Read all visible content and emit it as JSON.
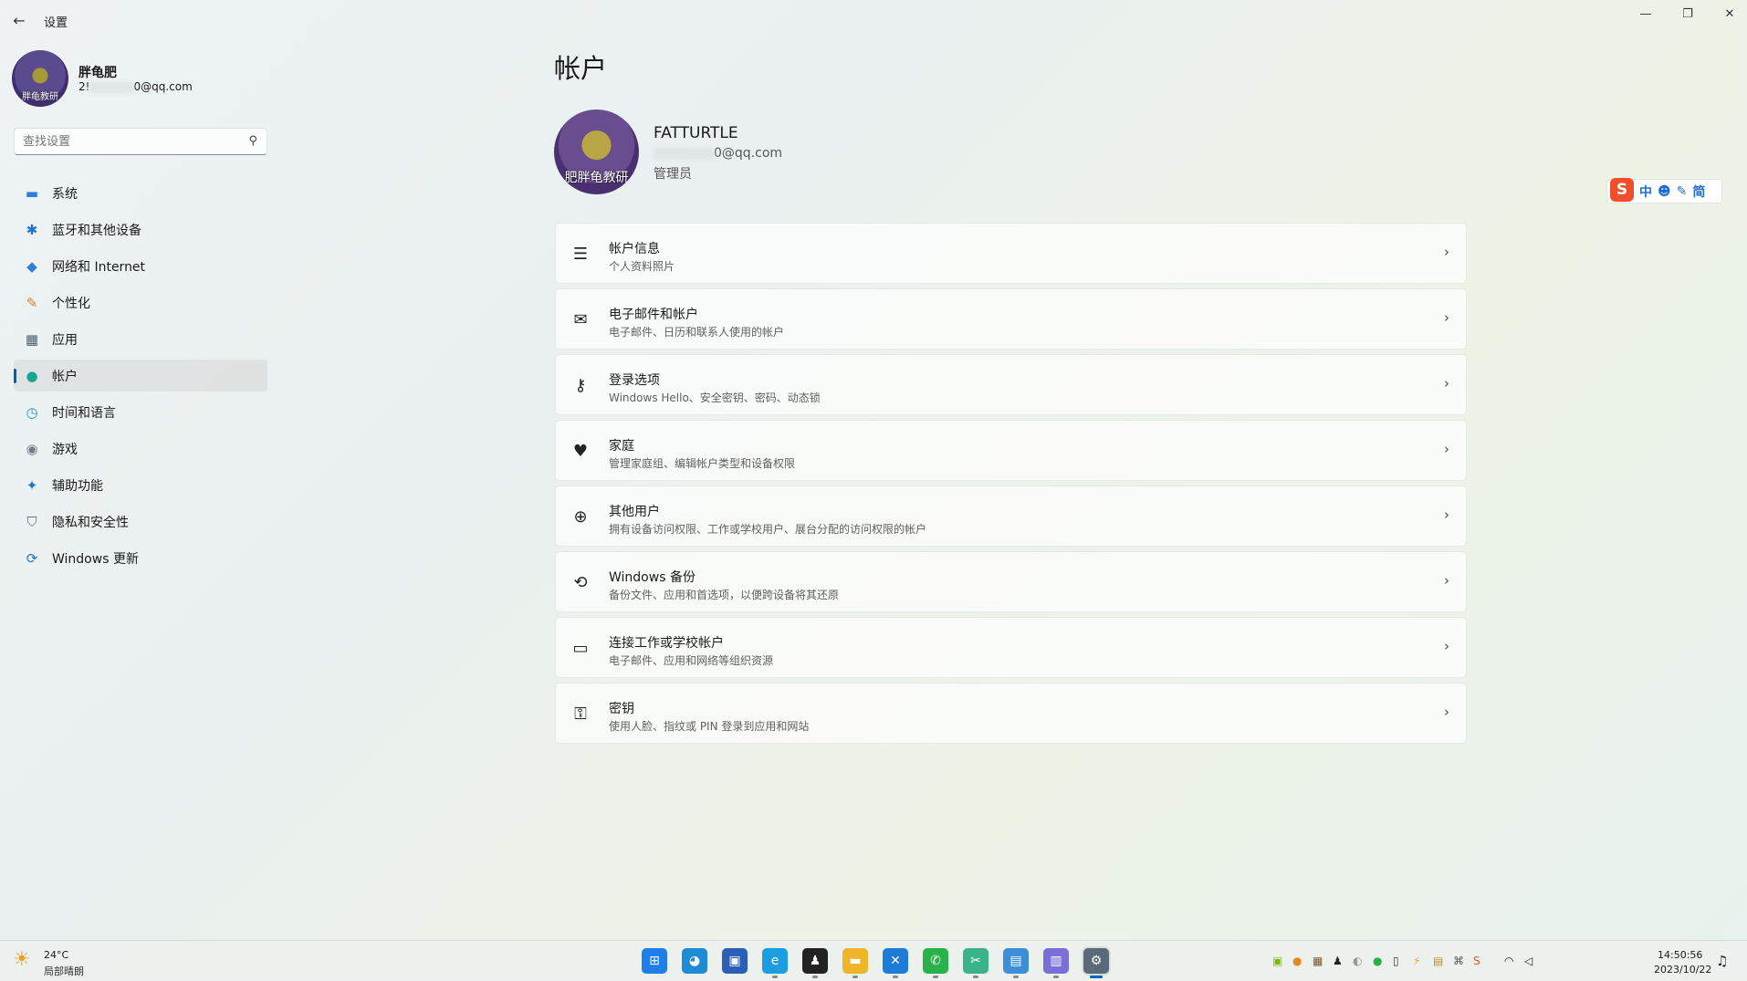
{
  "window": {
    "title": "设置",
    "back_icon": "back-arrow-icon",
    "minimize_glyph": "—",
    "restore_glyph": "❐",
    "close_glyph": "✕"
  },
  "profile": {
    "name": "胖龟肥",
    "email_prefix": "2!",
    "email_suffix": "0@qq.com",
    "avatar_caption": "胖龟教研"
  },
  "search": {
    "placeholder": "查找设置"
  },
  "nav": {
    "items": [
      {
        "label": "系统",
        "icon": "system-icon",
        "glyph": "▬",
        "color": "#2a80d9"
      },
      {
        "label": "蓝牙和其他设备",
        "icon": "bluetooth-icon",
        "glyph": "✱",
        "color": "#1f73d0"
      },
      {
        "label": "网络和 Internet",
        "icon": "wifi-icon",
        "glyph": "◆",
        "color": "#2b7fd8"
      },
      {
        "label": "个性化",
        "icon": "brush-icon",
        "glyph": "✎",
        "color": "#d9822b"
      },
      {
        "label": "应用",
        "icon": "apps-icon",
        "glyph": "▦",
        "color": "#4b5e72"
      },
      {
        "label": "帐户",
        "icon": "account-icon",
        "glyph": "●",
        "color": "#1aa58e"
      },
      {
        "label": "时间和语言",
        "icon": "globe-clock-icon",
        "glyph": "◷",
        "color": "#2b8fd6"
      },
      {
        "label": "游戏",
        "icon": "gamepad-icon",
        "glyph": "◉",
        "color": "#6f7b86"
      },
      {
        "label": "辅助功能",
        "icon": "accessibility-icon",
        "glyph": "✦",
        "color": "#1f73d0"
      },
      {
        "label": "隐私和安全性",
        "icon": "shield-icon",
        "glyph": "⛉",
        "color": "#6b7480"
      },
      {
        "label": "Windows 更新",
        "icon": "update-icon",
        "glyph": "⟳",
        "color": "#1f73d0"
      }
    ]
  },
  "main": {
    "title": "帐户",
    "account": {
      "name": "FATTURTLE",
      "email_suffix": "0@qq.com",
      "role": "管理员",
      "avatar_caption": "肥胖龟教研"
    },
    "cards": [
      {
        "title": "帐户信息",
        "desc": "个人资料照片",
        "icon": "person-info-icon",
        "glyph": "☰"
      },
      {
        "title": "电子邮件和帐户",
        "desc": "电子邮件、日历和联系人使用的帐户",
        "icon": "mail-icon",
        "glyph": "✉"
      },
      {
        "title": "登录选项",
        "desc": "Windows Hello、安全密钥、密码、动态锁",
        "icon": "key-icon",
        "glyph": "⚷"
      },
      {
        "title": "家庭",
        "desc": "管理家庭组、编辑帐户类型和设备权限",
        "icon": "family-heart-icon",
        "glyph": "♥"
      },
      {
        "title": "其他用户",
        "desc": "拥有设备访问权限、工作或学校用户、展台分配的访问权限的帐户",
        "icon": "add-user-icon",
        "glyph": "⊕"
      },
      {
        "title": "Windows 备份",
        "desc": "备份文件、应用和首选项，以便跨设备将其还原",
        "icon": "backup-icon",
        "glyph": "⟲"
      },
      {
        "title": "连接工作或学校帐户",
        "desc": "电子邮件、应用和网络等组织资源",
        "icon": "briefcase-icon",
        "glyph": "▭"
      },
      {
        "title": "密钥",
        "desc": "使用人脸、指纹或 PIN 登录到应用和网站",
        "icon": "passkey-icon",
        "glyph": "⚿"
      }
    ],
    "chevron": "›"
  },
  "ime": {
    "logo": "S",
    "items": [
      "中",
      "☻",
      "✎",
      "简"
    ]
  },
  "taskbar": {
    "weather_temp": "24°C",
    "weather_desc": "局部晴朗",
    "weather_icon": "sun-cloud-icon",
    "apps": [
      {
        "name": "start-icon",
        "color": "#1f7ee8",
        "glyph": "⊞"
      },
      {
        "name": "edge-preview-icon",
        "color": "#1f8ad6",
        "glyph": "◕"
      },
      {
        "name": "store-icon",
        "color": "#2b5fb5",
        "glyph": "▣"
      },
      {
        "name": "edge-icon",
        "color": "#1b9de2",
        "glyph": "e"
      },
      {
        "name": "qq-icon",
        "color": "#222222",
        "glyph": "♟"
      },
      {
        "name": "explorer-icon",
        "color": "#f0b429",
        "glyph": "▬"
      },
      {
        "name": "vscode-icon",
        "color": "#1e7bd6",
        "glyph": "✕"
      },
      {
        "name": "wechat-icon",
        "color": "#2ab24a",
        "glyph": "✆"
      },
      {
        "name": "xmind-icon",
        "color": "#3bb38a",
        "glyph": "✂"
      },
      {
        "name": "remote-desktop-icon",
        "color": "#3c8fd6",
        "glyph": "▤"
      },
      {
        "name": "copilot-icon",
        "color": "#7a6fd6",
        "glyph": "▥"
      },
      {
        "name": "settings-icon",
        "color": "#5a6a7a",
        "glyph": "⚙"
      }
    ],
    "tray": [
      {
        "name": "nvidia-icon",
        "glyph": "▣",
        "color": "#76b900"
      },
      {
        "name": "tray-app-icon",
        "glyph": "●",
        "color": "#e08a1e"
      },
      {
        "name": "tray-app2-icon",
        "glyph": "▦",
        "color": "#7a5a2a"
      },
      {
        "name": "qq-tray-icon",
        "glyph": "♟",
        "color": "#222222"
      },
      {
        "name": "tray-app3-icon",
        "glyph": "◐",
        "color": "#999999"
      },
      {
        "name": "wechat-tray-icon",
        "glyph": "●",
        "color": "#2ab24a"
      },
      {
        "name": "usb-icon",
        "glyph": "▯",
        "color": "#333333"
      },
      {
        "name": "tray-app4-icon",
        "glyph": "⚡",
        "color": "#f0a020"
      },
      {
        "name": "tray-app5-icon",
        "glyph": "▤",
        "color": "#c98a20"
      },
      {
        "name": "tray-app6-icon",
        "glyph": "⌘",
        "color": "#555555"
      },
      {
        "name": "sogou-tray-icon",
        "glyph": "S",
        "color": "#f04f2a"
      },
      {
        "name": "wifi-icon",
        "glyph": "◠",
        "color": "#222222"
      },
      {
        "name": "volume-icon",
        "glyph": "◁",
        "color": "#222222"
      }
    ],
    "time": "14:50:56",
    "date": "2023/10/22",
    "notification_icon": "bell-icon"
  }
}
